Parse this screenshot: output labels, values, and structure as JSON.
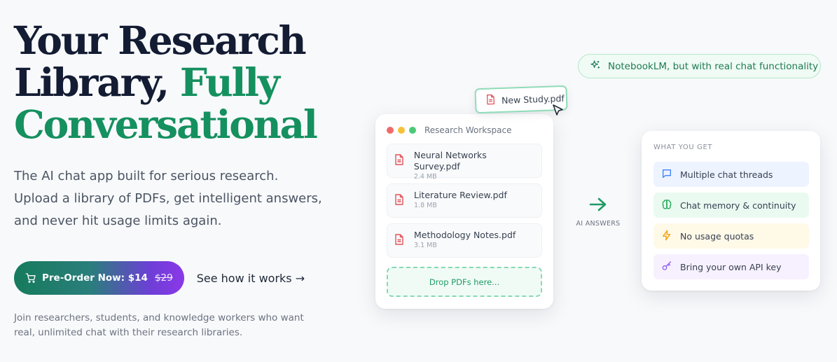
{
  "hero": {
    "title_line1": "Your Research",
    "title_line2a": "Library, ",
    "title_line2b": "Fully",
    "title_line3": "Conversational",
    "subtitle": "The AI chat app built for serious research. Upload a library of PDFs, get intelligent answers, and never hit usage limits again.",
    "cta_label": "Pre-Order Now: $14",
    "cta_old_price": "$29",
    "secondary_link": "See how it works →",
    "join_text": "Join researchers, students, and knowledge workers who want real, unlimited chat with their research libraries."
  },
  "pill": {
    "text": "NotebookLM, but with real chat functionality",
    "icon": "sparkles-icon"
  },
  "new_study": {
    "label": "New Study.pdf"
  },
  "workspace": {
    "title": "Research Workspace",
    "window_dots": [
      "#ef6b6b",
      "#f5c13b",
      "#4cc978"
    ],
    "files": [
      {
        "name": "Neural Networks Survey.pdf",
        "size": "2.4 MB"
      },
      {
        "name": "Literature Review.pdf",
        "size": "1.8 MB"
      },
      {
        "name": "Methodology Notes.pdf",
        "size": "3.1 MB"
      }
    ],
    "dropzone": "Drop PDFs here..."
  },
  "ai": {
    "label": "AI ANSWERS"
  },
  "features": {
    "title": "WHAT YOU GET",
    "items": [
      {
        "label": "Multiple chat threads",
        "icon": "chat-bubble-icon",
        "color": "#3b82f6"
      },
      {
        "label": "Chat memory & continuity",
        "icon": "brain-icon",
        "color": "#16a34a"
      },
      {
        "label": "No usage quotas",
        "icon": "lightning-icon",
        "color": "#f59e0b"
      },
      {
        "label": "Bring your own API key",
        "icon": "key-icon",
        "color": "#8b5cf6"
      }
    ]
  },
  "colors": {
    "accent_green": "#15905f",
    "title_dark": "#131c33",
    "pdf_red": "#e0525a"
  }
}
